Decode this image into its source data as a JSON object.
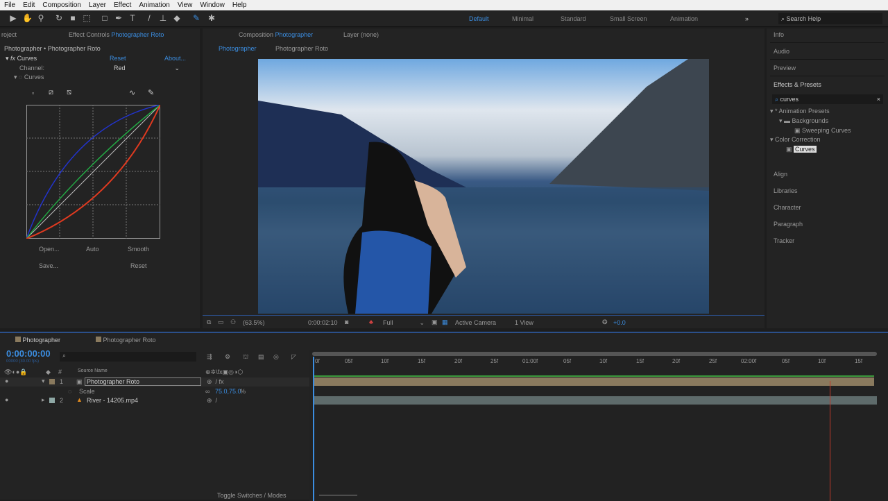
{
  "menu": [
    "File",
    "Edit",
    "Composition",
    "Layer",
    "Effect",
    "Animation",
    "View",
    "Window",
    "Help"
  ],
  "workspaces": [
    "Default",
    "Minimal",
    "Standard",
    "Small Screen",
    "Animation"
  ],
  "search_help": "Search Help",
  "effect_controls": {
    "project_tab": "roject",
    "tab_label": "Effect Controls",
    "tab_target": "Photographer Roto",
    "breadcrumb": "Photographer • Photographer Roto",
    "effect_name": "Curves",
    "reset": "Reset",
    "about": "About...",
    "channel_label": "Channel:",
    "channel_value": "Red",
    "curves_label": "Curves",
    "open": "Open...",
    "auto": "Auto",
    "smooth": "Smooth",
    "save": "Save...",
    "reset2": "Reset"
  },
  "composition": {
    "tab_label": "Composition",
    "tab_target": "Photographer",
    "layer_tab": "Layer (none)",
    "crumbs": [
      "Photographer",
      "Photographer Roto"
    ],
    "zoom": "(63.5%)",
    "timecode": "0:00:02:10",
    "resolution": "Full",
    "camera": "Active Camera",
    "views": "1 View",
    "exposure": "+0.0"
  },
  "right_panel": {
    "sections_top": [
      "Info",
      "Audio",
      "Preview"
    ],
    "effects_presets": "Effects & Presets",
    "search_value": "curves",
    "tree": [
      "* Animation Presets",
      "Backgrounds",
      "Sweeping Curves",
      "Color Correction",
      "Curves"
    ],
    "sections_bottom": [
      "Align",
      "Libraries",
      "Character",
      "Paragraph",
      "Tracker"
    ]
  },
  "timeline": {
    "tabs": [
      "Photographer",
      "Photographer Roto"
    ],
    "timecode": "0:00:00:00",
    "fps": "00000 (30.00 fps)",
    "source_name_header": "Source Name",
    "layers": [
      {
        "num": "1",
        "name": "Photographer Roto"
      },
      {
        "num": "2",
        "name": "River - 14205.mp4"
      }
    ],
    "scale_label": "Scale",
    "scale_value": "75.0,75.0",
    "scale_unit": "%",
    "ruler": [
      "0f",
      "05f",
      "10f",
      "15f",
      "20f",
      "25f",
      "01:00f",
      "05f",
      "10f",
      "15f",
      "20f",
      "25f",
      "02:00f",
      "05f",
      "10f",
      "15f"
    ],
    "toggle": "Toggle Switches / Modes"
  },
  "colors": {
    "accent": "#3b8de0",
    "layer1": "#8a7a5e",
    "layer2": "#5e6b6b",
    "playhead_end": "#c0392b"
  }
}
